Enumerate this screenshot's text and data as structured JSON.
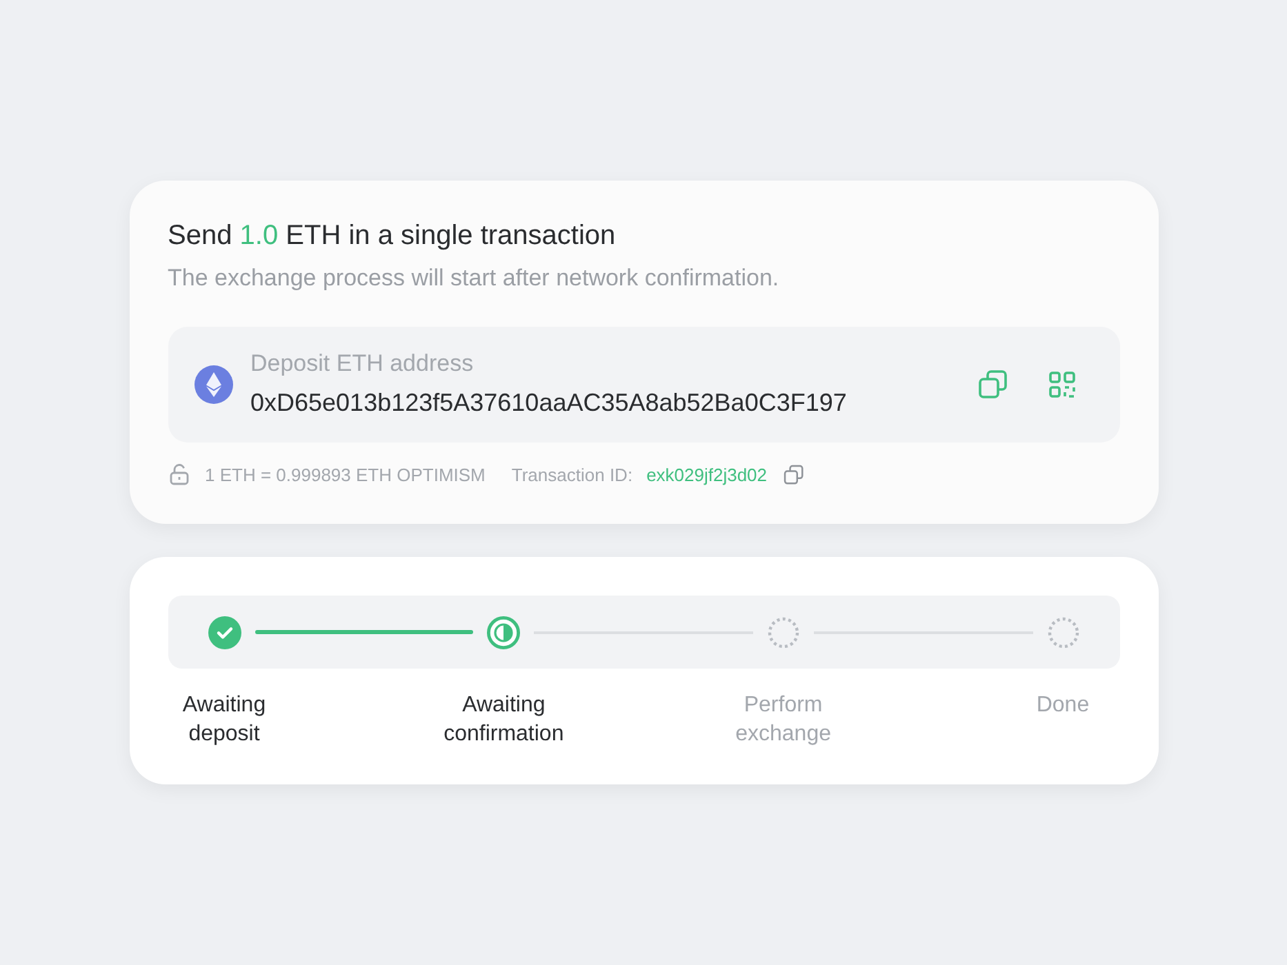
{
  "deposit_card": {
    "title": {
      "before": "Send",
      "amount": "1.0",
      "after": "ETH in a single transaction"
    },
    "subtitle": "The exchange process will start after network confirmation.",
    "address_box": {
      "label": "Deposit ETH address",
      "address": "0xD65e013b123f5A37610aaAC35A8ab52Ba0C3F197"
    },
    "rate": "1 ETH = 0.999893 ETH OPTIMISM",
    "transaction_label": "Transaction ID:",
    "transaction_id": "exk029jf2j3d02"
  },
  "progress": {
    "steps": [
      {
        "label": "Awaiting deposit",
        "kind": "done"
      },
      {
        "label": "Awaiting confirmation",
        "kind": "current"
      },
      {
        "label": "Perform exchange",
        "kind": "pending"
      },
      {
        "label": "Done",
        "kind": "pending"
      }
    ]
  }
}
